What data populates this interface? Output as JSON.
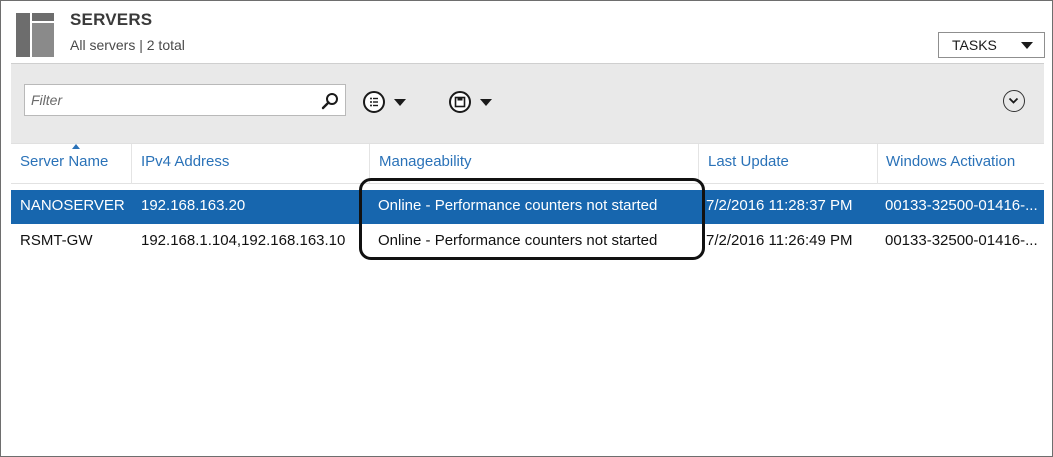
{
  "header": {
    "title": "SERVERS",
    "subtitle": "All servers | 2 total",
    "tasks_label": "TASKS"
  },
  "toolbar": {
    "filter_placeholder": "Filter",
    "icons": [
      "server-tile-icon",
      "search-icon",
      "list-options-icon",
      "save-icon",
      "expand-icon"
    ]
  },
  "table": {
    "columns": [
      "Server Name",
      "IPv4 Address",
      "Manageability",
      "Last Update",
      "Windows Activation"
    ],
    "sorted_column": "Server Name",
    "rows": [
      {
        "server_name": "NANOSERVER",
        "ipv4": "192.168.163.20",
        "manageability": "Online - Performance counters not started",
        "last_update": "7/2/2016 11:28:37 PM",
        "activation": "00133-32500-01416-...",
        "selected": true
      },
      {
        "server_name": "RSMT-GW",
        "ipv4": "192.168.1.104,192.168.163.10",
        "manageability": "Online - Performance counters not started",
        "last_update": "7/2/2016 11:26:49 PM",
        "activation": "00133-32500-01416-...",
        "selected": false
      }
    ]
  },
  "colors": {
    "selection": "#1766ae",
    "header_link": "#2a72b8",
    "toolbar_bg": "#e9e9e9"
  }
}
